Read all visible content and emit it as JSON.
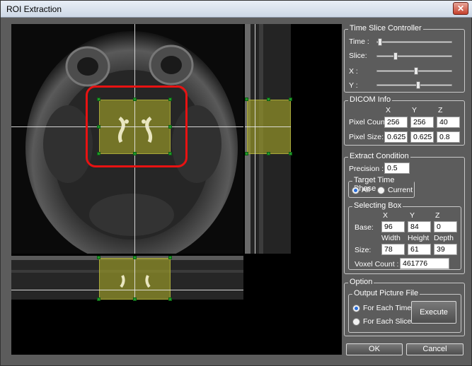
{
  "window": {
    "title": "ROI Extraction",
    "close_label": "✕"
  },
  "time_slice": {
    "title": "Time Slice Controller",
    "time_label": "Time :",
    "slice_label": "Slice:",
    "x_label": "X :",
    "y_label": "Y :",
    "time_value": 0.02,
    "slice_value": 0.24,
    "x_value": 0.52,
    "y_value": 0.55
  },
  "dicom_info": {
    "title": "DICOM Info",
    "col_x": "X",
    "col_y": "Y",
    "col_z": "Z",
    "pixel_count_label": "Pixel Count:",
    "pixel_size_label": "Pixel Size:",
    "pixel_count": {
      "x": "256",
      "y": "256",
      "z": "40"
    },
    "pixel_size": {
      "x": "0.625",
      "y": "0.625",
      "z": "0.8"
    }
  },
  "extract": {
    "title": "Extract Condition",
    "precision_label": "Precision :",
    "precision_value": "0.5",
    "target_phase": {
      "title": "Target Time Phase",
      "all_label": "All",
      "current_label": "Current",
      "selected": "All"
    },
    "selecting_box": {
      "title": "Selecting Box",
      "col_x": "X",
      "col_y": "Y",
      "col_z": "Z",
      "base_label": "Base:",
      "base": {
        "x": "96",
        "y": "84",
        "z": "0"
      },
      "width_label": "Width",
      "height_label": "Height",
      "depth_label": "Depth",
      "size_label": "Size:",
      "size": {
        "x": "78",
        "y": "61",
        "z": "39"
      },
      "voxel_label": "Voxel Count :",
      "voxel_count": "461776"
    }
  },
  "option": {
    "title": "Option",
    "output": {
      "title": "Output Picture File",
      "each_time_label": "For Each Time",
      "each_slice_label": "For Each Slice",
      "selected": "For Each Time"
    },
    "execute_label": "Execute"
  },
  "buttons": {
    "ok_label": "OK",
    "cancel_label": "Cancel"
  },
  "colors": {
    "roi_fill": "#9a9a30",
    "handle": "#1f9a2a",
    "highlight": "#e81212"
  }
}
